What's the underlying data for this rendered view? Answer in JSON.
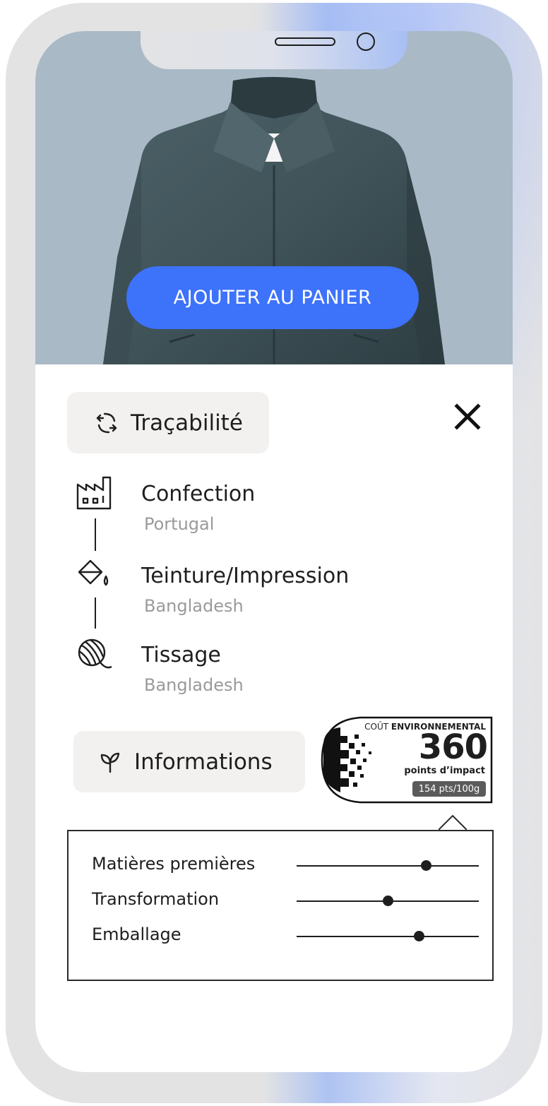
{
  "product": {
    "add_to_cart_label": "AJOUTER AU PANIER",
    "image_icon": "jacket-image"
  },
  "traceability": {
    "chip_label": "Traçabilité",
    "chip_icon": "recycle-arrows-icon",
    "steps": [
      {
        "name": "Confection",
        "place": "Portugal",
        "icon": "factory-icon"
      },
      {
        "name": "Teinture/Impression",
        "place": "Bangladesh",
        "icon": "paint-bucket-icon"
      },
      {
        "name": "Tissage",
        "place": "Bangladesh",
        "icon": "yarn-ball-icon"
      }
    ]
  },
  "information": {
    "chip_label": "Informations",
    "chip_icon": "sprout-icon"
  },
  "eco_badge": {
    "prefix": "COÛT",
    "title": "ENVIRONNEMENTAL",
    "score": "360",
    "unit": "points d’impact",
    "per_weight": "154 pts/100g"
  },
  "impact_breakdown": [
    {
      "label": "Matières premières",
      "level": 0.71
    },
    {
      "label": "Transformation",
      "level": 0.5
    },
    {
      "label": "Emballage",
      "level": 0.67
    }
  ],
  "colors": {
    "accent": "#3d72fb",
    "hero_background": "#a9b9c6",
    "chip_background": "#f2f1ef",
    "muted_text": "#9a9a9a"
  }
}
